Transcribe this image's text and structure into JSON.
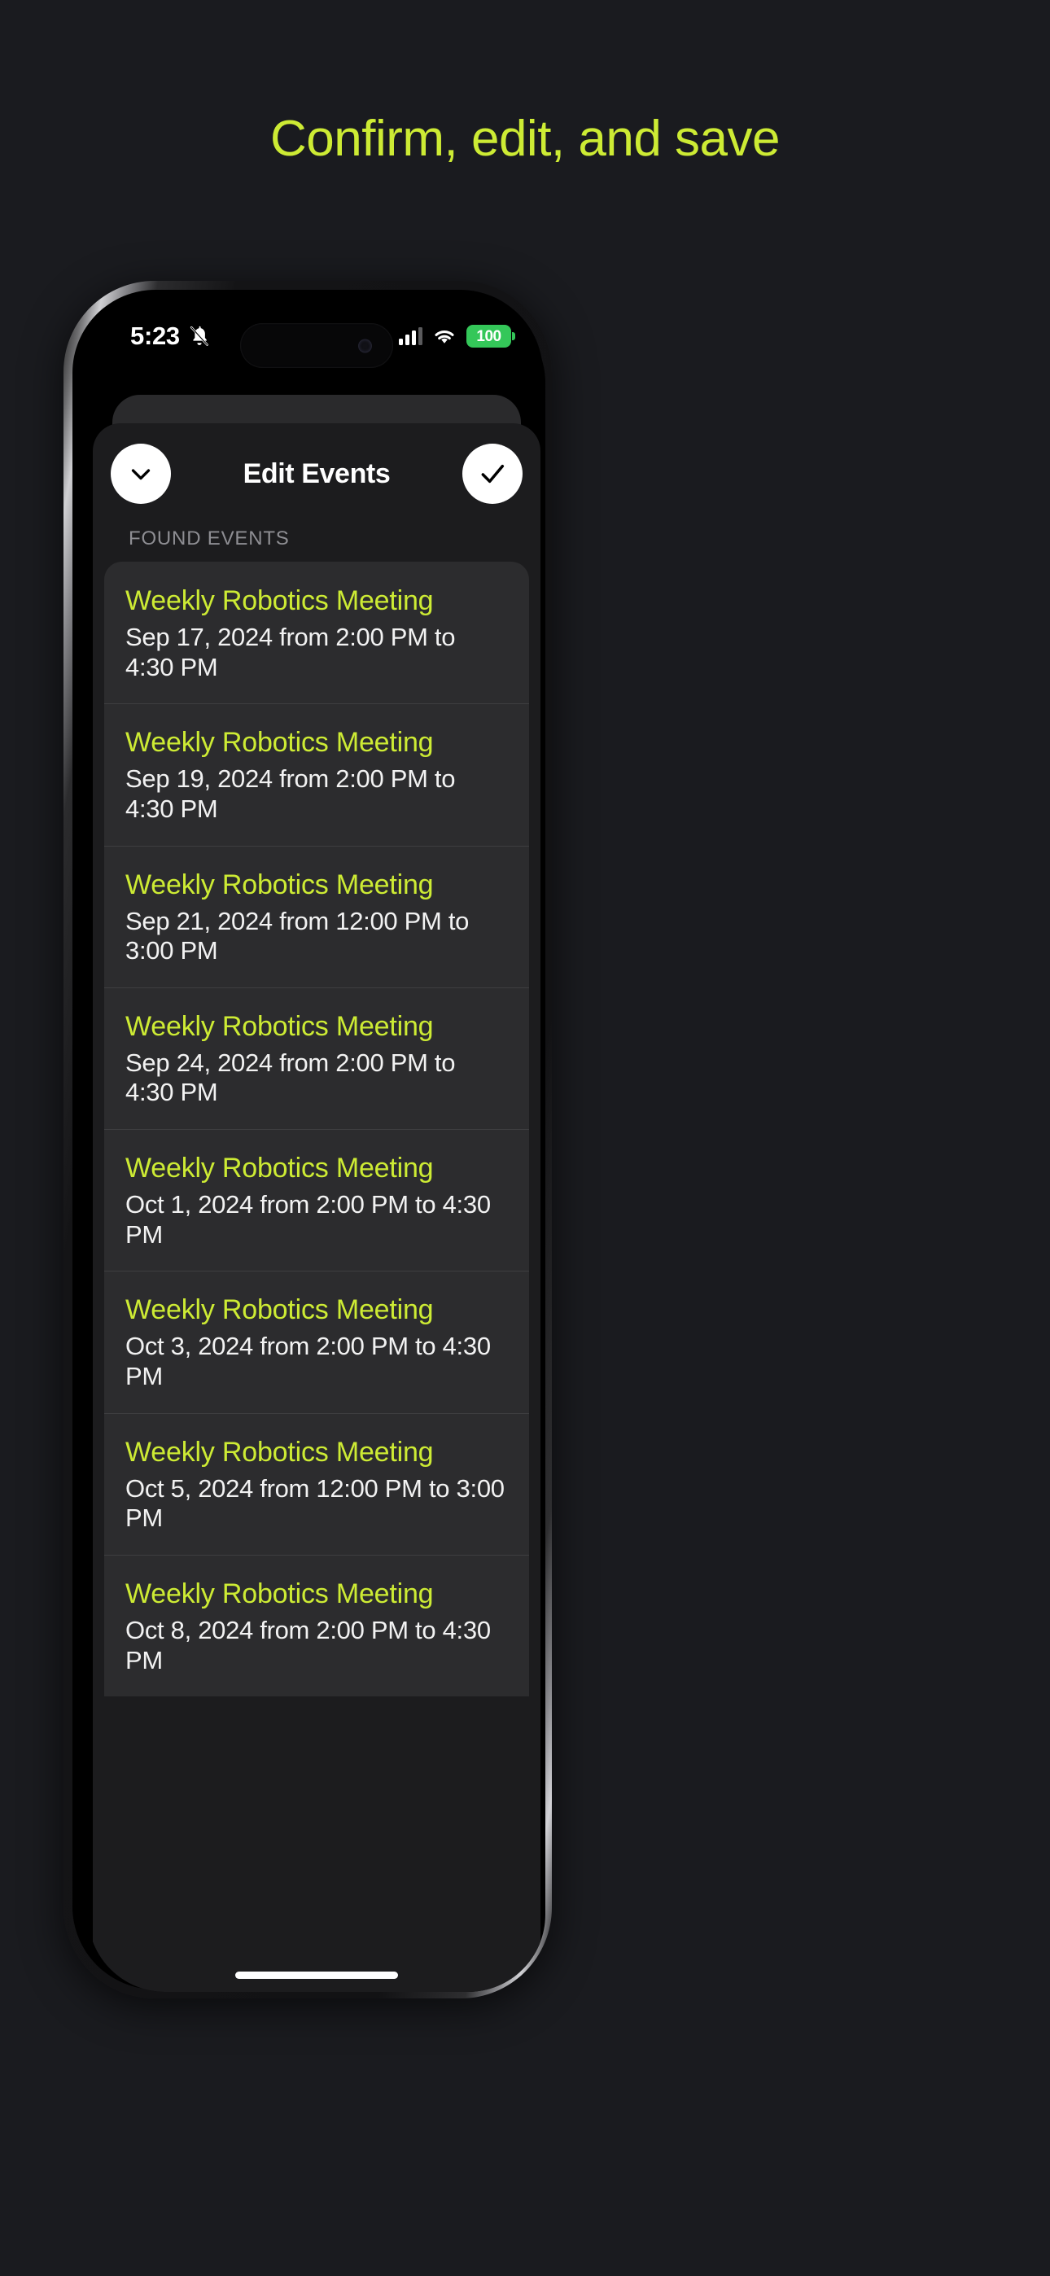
{
  "page": {
    "title": "Confirm, edit, and save",
    "accent_color": "#cdeb34",
    "background_color": "#1a1b1f"
  },
  "status_bar": {
    "time": "5:23",
    "silent_icon": "bell-slash-icon",
    "cellular_icon": "cellular-bars-icon",
    "wifi_icon": "wifi-icon",
    "battery_percent": "100",
    "battery_color": "#34c759"
  },
  "navbar": {
    "title": "Edit Events",
    "left_button": {
      "icon": "chevron-down-icon",
      "label": "Dismiss"
    },
    "right_button": {
      "icon": "checkmark-icon",
      "label": "Confirm"
    }
  },
  "section": {
    "header": "FOUND EVENTS"
  },
  "events": [
    {
      "title": "Weekly Robotics Meeting",
      "when": "Sep 17, 2024 from 2:00 PM to 4:30 PM"
    },
    {
      "title": "Weekly Robotics Meeting",
      "when": "Sep 19, 2024 from 2:00 PM to 4:30 PM"
    },
    {
      "title": "Weekly Robotics Meeting",
      "when": "Sep 21, 2024 from 12:00 PM to 3:00 PM"
    },
    {
      "title": "Weekly Robotics Meeting",
      "when": "Sep 24, 2024 from 2:00 PM to 4:30 PM"
    },
    {
      "title": "Weekly Robotics Meeting",
      "when": "Oct 1, 2024 from 2:00 PM to 4:30 PM"
    },
    {
      "title": "Weekly Robotics Meeting",
      "when": "Oct 3, 2024 from 2:00 PM to 4:30 PM"
    },
    {
      "title": "Weekly Robotics Meeting",
      "when": "Oct 5, 2024 from 12:00 PM to 3:00 PM"
    },
    {
      "title": "Weekly Robotics Meeting",
      "when": "Oct 8, 2024 from 2:00 PM to 4:30 PM"
    }
  ]
}
